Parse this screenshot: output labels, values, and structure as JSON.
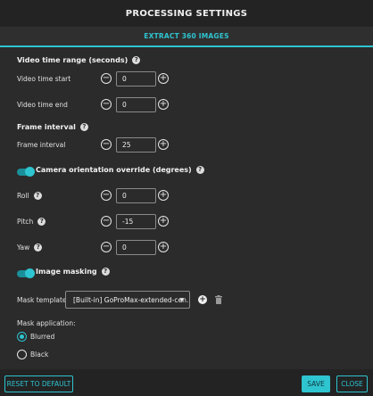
{
  "header": {
    "title": "PROCESSING SETTINGS"
  },
  "tab": {
    "label": "EXTRACT 360 IMAGES"
  },
  "video_range": {
    "title": "Video time range (seconds)",
    "start_label": "Video time start",
    "start_value": "0",
    "end_label": "Video time end",
    "end_value": "0"
  },
  "frame": {
    "title": "Frame interval",
    "label": "Frame interval",
    "value": "25"
  },
  "orientation": {
    "title": "Camera orientation override (degrees)",
    "enabled": true,
    "roll_label": "Roll",
    "roll_value": "0",
    "pitch_label": "Pitch",
    "pitch_value": "-15",
    "yaw_label": "Yaw",
    "yaw_value": "0"
  },
  "masking": {
    "title": "Image masking",
    "enabled": true,
    "template_label": "Mask template:",
    "template_value": "[Built-in] GoProMax-extended-cen...",
    "application_label": "Mask application:",
    "options": [
      "Blurred",
      "Black"
    ],
    "selected": "Blurred"
  },
  "footer": {
    "reset_label": "RESET TO DEFAULT",
    "save_label": "SAVE",
    "close_label": "CLOSE"
  },
  "colors": {
    "accent": "#2ec4d0",
    "background": "#2b2b2b",
    "header": "#232323"
  },
  "icons": {
    "help": "help-icon",
    "minus": "minus-circle-icon",
    "plus": "plus-circle-icon",
    "add": "add-filled-icon",
    "delete": "trash-icon",
    "caret": "caret-down-icon"
  }
}
